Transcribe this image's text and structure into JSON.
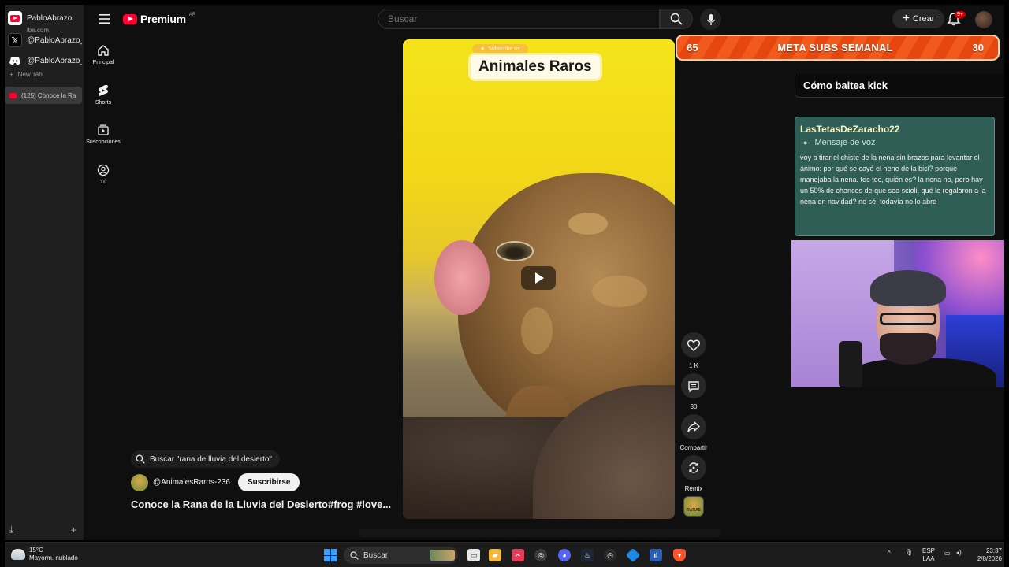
{
  "browser": {
    "profiles": [
      {
        "label": "PabloAbrazo",
        "icon": "youtube-icon"
      },
      {
        "label": "@PabloAbrazo_",
        "icon": "x-icon"
      },
      {
        "label": "@PabloAbrazo_",
        "icon": "discord-icon"
      }
    ],
    "url_fragment": "ibe.com",
    "new_tab_label": "New Tab",
    "active_tab_label": "(125) Conoce la Ra"
  },
  "header": {
    "logo_text": "Premium",
    "country_code": "AR",
    "search_placeholder": "Buscar",
    "create_label": "Crear",
    "notification_badge": "9+"
  },
  "guide": {
    "items": [
      {
        "label": "Principal",
        "icon": "home-icon"
      },
      {
        "label": "Shorts",
        "icon": "shorts-icon"
      },
      {
        "label": "Suscripciones",
        "icon": "subscriptions-icon"
      },
      {
        "label": "Tú",
        "icon": "user-icon"
      }
    ]
  },
  "short": {
    "overlay_subscribe": "Subscribe us",
    "overlay_title": "Animales Raros",
    "related_search": "Buscar \"rana de lluvia del desierto\"",
    "channel_handle": "@AnimalesRaros-236",
    "subscribe_label": "Suscribirse",
    "title": "Conoce la Rana de la Lluvia del Desierto#frog #love...",
    "sound_thumb_text": "RARAS",
    "actions": {
      "like_count": "1 K",
      "comment_count": "30",
      "share_label": "Compartir",
      "remix_label": "Remix"
    }
  },
  "stream": {
    "goal": {
      "current": "65",
      "label": "META SUBS SEMANAL",
      "target": "30"
    },
    "alert_title": "Cómo baitea kick",
    "voice_message": {
      "user": "LasTetasDeZaracho22",
      "kind": "Mensaje de voz",
      "text": "voy a tirar el chiste de la nena sin brazos para levantar el ánimo: por qué se cayó el nene de la bici? porque manejaba la nena. toc toc, quién es? la nena no, pero hay un 50% de chances de que sea scioli. qué le regalaron a la nena en navidad? no sé, todavía no lo abre"
    }
  },
  "taskbar": {
    "weather_temp": "15°C",
    "weather_desc": "Mayorm. nublado",
    "search_label": "Buscar",
    "lang_line1": "ESP",
    "lang_line2": "LAA",
    "time": "23:37",
    "date": "2/8/2026"
  },
  "colors": {
    "youtube_red": "#ff0033",
    "goal_orange": "#f15a1c",
    "voice_card_green": "#2f5e56"
  }
}
